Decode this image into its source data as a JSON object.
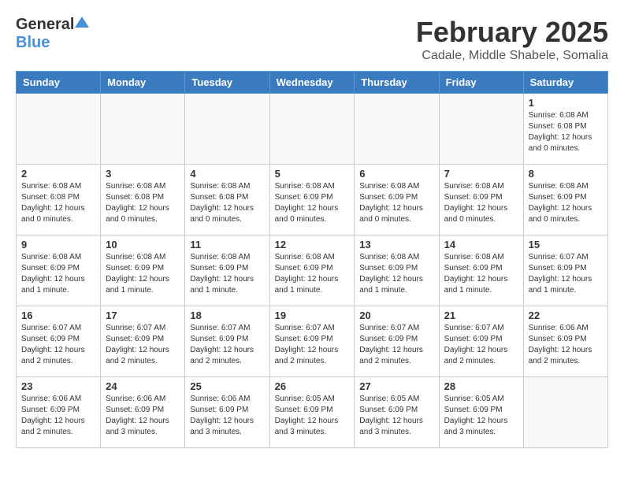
{
  "header": {
    "logo_general": "General",
    "logo_blue": "Blue",
    "title": "February 2025",
    "subtitle": "Cadale, Middle Shabele, Somalia"
  },
  "calendar": {
    "days_of_week": [
      "Sunday",
      "Monday",
      "Tuesday",
      "Wednesday",
      "Thursday",
      "Friday",
      "Saturday"
    ],
    "weeks": [
      [
        {
          "day": "",
          "info": ""
        },
        {
          "day": "",
          "info": ""
        },
        {
          "day": "",
          "info": ""
        },
        {
          "day": "",
          "info": ""
        },
        {
          "day": "",
          "info": ""
        },
        {
          "day": "",
          "info": ""
        },
        {
          "day": "1",
          "info": "Sunrise: 6:08 AM\nSunset: 6:08 PM\nDaylight: 12 hours and 0 minutes."
        }
      ],
      [
        {
          "day": "2",
          "info": "Sunrise: 6:08 AM\nSunset: 6:08 PM\nDaylight: 12 hours and 0 minutes."
        },
        {
          "day": "3",
          "info": "Sunrise: 6:08 AM\nSunset: 6:08 PM\nDaylight: 12 hours and 0 minutes."
        },
        {
          "day": "4",
          "info": "Sunrise: 6:08 AM\nSunset: 6:08 PM\nDaylight: 12 hours and 0 minutes."
        },
        {
          "day": "5",
          "info": "Sunrise: 6:08 AM\nSunset: 6:09 PM\nDaylight: 12 hours and 0 minutes."
        },
        {
          "day": "6",
          "info": "Sunrise: 6:08 AM\nSunset: 6:09 PM\nDaylight: 12 hours and 0 minutes."
        },
        {
          "day": "7",
          "info": "Sunrise: 6:08 AM\nSunset: 6:09 PM\nDaylight: 12 hours and 0 minutes."
        },
        {
          "day": "8",
          "info": "Sunrise: 6:08 AM\nSunset: 6:09 PM\nDaylight: 12 hours and 0 minutes."
        }
      ],
      [
        {
          "day": "9",
          "info": "Sunrise: 6:08 AM\nSunset: 6:09 PM\nDaylight: 12 hours and 1 minute."
        },
        {
          "day": "10",
          "info": "Sunrise: 6:08 AM\nSunset: 6:09 PM\nDaylight: 12 hours and 1 minute."
        },
        {
          "day": "11",
          "info": "Sunrise: 6:08 AM\nSunset: 6:09 PM\nDaylight: 12 hours and 1 minute."
        },
        {
          "day": "12",
          "info": "Sunrise: 6:08 AM\nSunset: 6:09 PM\nDaylight: 12 hours and 1 minute."
        },
        {
          "day": "13",
          "info": "Sunrise: 6:08 AM\nSunset: 6:09 PM\nDaylight: 12 hours and 1 minute."
        },
        {
          "day": "14",
          "info": "Sunrise: 6:08 AM\nSunset: 6:09 PM\nDaylight: 12 hours and 1 minute."
        },
        {
          "day": "15",
          "info": "Sunrise: 6:07 AM\nSunset: 6:09 PM\nDaylight: 12 hours and 1 minute."
        }
      ],
      [
        {
          "day": "16",
          "info": "Sunrise: 6:07 AM\nSunset: 6:09 PM\nDaylight: 12 hours and 2 minutes."
        },
        {
          "day": "17",
          "info": "Sunrise: 6:07 AM\nSunset: 6:09 PM\nDaylight: 12 hours and 2 minutes."
        },
        {
          "day": "18",
          "info": "Sunrise: 6:07 AM\nSunset: 6:09 PM\nDaylight: 12 hours and 2 minutes."
        },
        {
          "day": "19",
          "info": "Sunrise: 6:07 AM\nSunset: 6:09 PM\nDaylight: 12 hours and 2 minutes."
        },
        {
          "day": "20",
          "info": "Sunrise: 6:07 AM\nSunset: 6:09 PM\nDaylight: 12 hours and 2 minutes."
        },
        {
          "day": "21",
          "info": "Sunrise: 6:07 AM\nSunset: 6:09 PM\nDaylight: 12 hours and 2 minutes."
        },
        {
          "day": "22",
          "info": "Sunrise: 6:06 AM\nSunset: 6:09 PM\nDaylight: 12 hours and 2 minutes."
        }
      ],
      [
        {
          "day": "23",
          "info": "Sunrise: 6:06 AM\nSunset: 6:09 PM\nDaylight: 12 hours and 2 minutes."
        },
        {
          "day": "24",
          "info": "Sunrise: 6:06 AM\nSunset: 6:09 PM\nDaylight: 12 hours and 3 minutes."
        },
        {
          "day": "25",
          "info": "Sunrise: 6:06 AM\nSunset: 6:09 PM\nDaylight: 12 hours and 3 minutes."
        },
        {
          "day": "26",
          "info": "Sunrise: 6:05 AM\nSunset: 6:09 PM\nDaylight: 12 hours and 3 minutes."
        },
        {
          "day": "27",
          "info": "Sunrise: 6:05 AM\nSunset: 6:09 PM\nDaylight: 12 hours and 3 minutes."
        },
        {
          "day": "28",
          "info": "Sunrise: 6:05 AM\nSunset: 6:09 PM\nDaylight: 12 hours and 3 minutes."
        },
        {
          "day": "",
          "info": ""
        }
      ]
    ]
  }
}
